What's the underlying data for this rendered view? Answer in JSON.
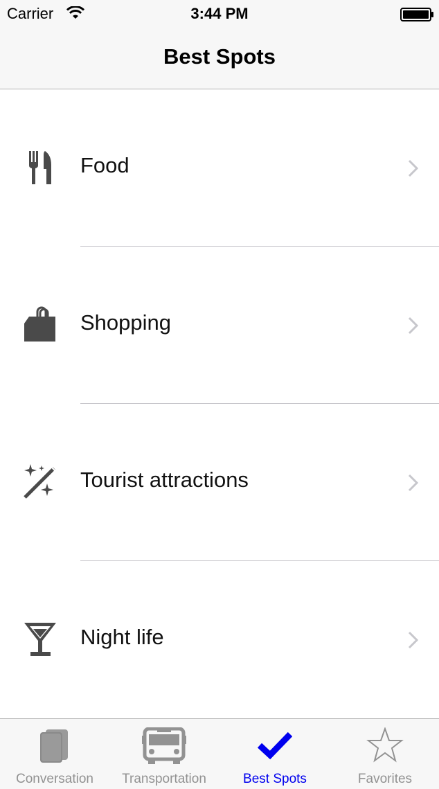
{
  "status_bar": {
    "carrier": "Carrier",
    "time": "3:44 PM"
  },
  "nav": {
    "title": "Best Spots"
  },
  "list": {
    "items": [
      {
        "label": "Food",
        "icon": "fork-knife-icon"
      },
      {
        "label": "Shopping",
        "icon": "shopping-bag-icon"
      },
      {
        "label": "Tourist attractions",
        "icon": "magic-wand-icon"
      },
      {
        "label": "Night life",
        "icon": "cocktail-glass-icon"
      }
    ]
  },
  "tab_bar": {
    "tabs": [
      {
        "label": "Conversation",
        "icon": "book-icon",
        "active": false
      },
      {
        "label": "Transportation",
        "icon": "bus-icon",
        "active": false
      },
      {
        "label": "Best Spots",
        "icon": "checkmark-icon",
        "active": true
      },
      {
        "label": "Favorites",
        "icon": "star-icon",
        "active": false
      }
    ]
  },
  "colors": {
    "active_tab": "#0000ee",
    "inactive_tab": "#929292",
    "icon_gray": "#4a4a4a"
  }
}
